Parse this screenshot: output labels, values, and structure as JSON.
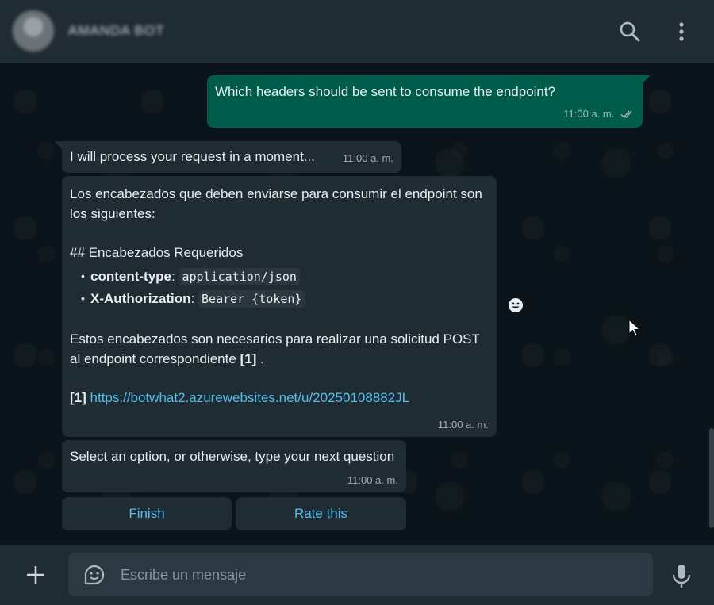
{
  "header": {
    "contact_name": "AMANDA BOT",
    "icons": [
      "search-icon",
      "menu-dots-icon"
    ]
  },
  "messages": {
    "outgoing": {
      "text": "Which headers should be sent to consume the endpoint?",
      "time": "11:00 a. m.",
      "status_icon": "double-check-icon"
    },
    "processing": {
      "text": "I will process your request in a moment...",
      "time": "11:00 a. m."
    },
    "answer": {
      "intro": "Los encabezados que deben enviarse para consumir el endpoint son los siguientes:",
      "heading": "## Encabezados Requeridos",
      "headers": [
        {
          "name": "content-type",
          "sep": ":",
          "value": "application/json"
        },
        {
          "name": "X-Authorization",
          "sep": ":",
          "value": "Bearer {token}"
        }
      ],
      "body": "Estos encabezados son necesarios para realizar una solicitud POST al endpoint correspondiente",
      "ref": "[1]",
      "ref_suffix": " .",
      "footnote_ref": "[1]",
      "link": "https://botwhat2.azurewebsites.net/u/20250108882JL",
      "time": "11:00 a. m."
    },
    "prompt": {
      "text": "Select an option, or otherwise, type your next question",
      "time": "11:00 a. m."
    }
  },
  "buttons": {
    "finish": "Finish",
    "rate": "Rate this"
  },
  "composer": {
    "placeholder": "Escribe un mensaje",
    "icons": [
      "plus-icon",
      "sticker-icon",
      "mic-icon"
    ]
  },
  "colors": {
    "outgoing_bubble": "#005c4b",
    "incoming_bubble": "#202c33",
    "link": "#53bdeb",
    "background": "#0b141a"
  }
}
